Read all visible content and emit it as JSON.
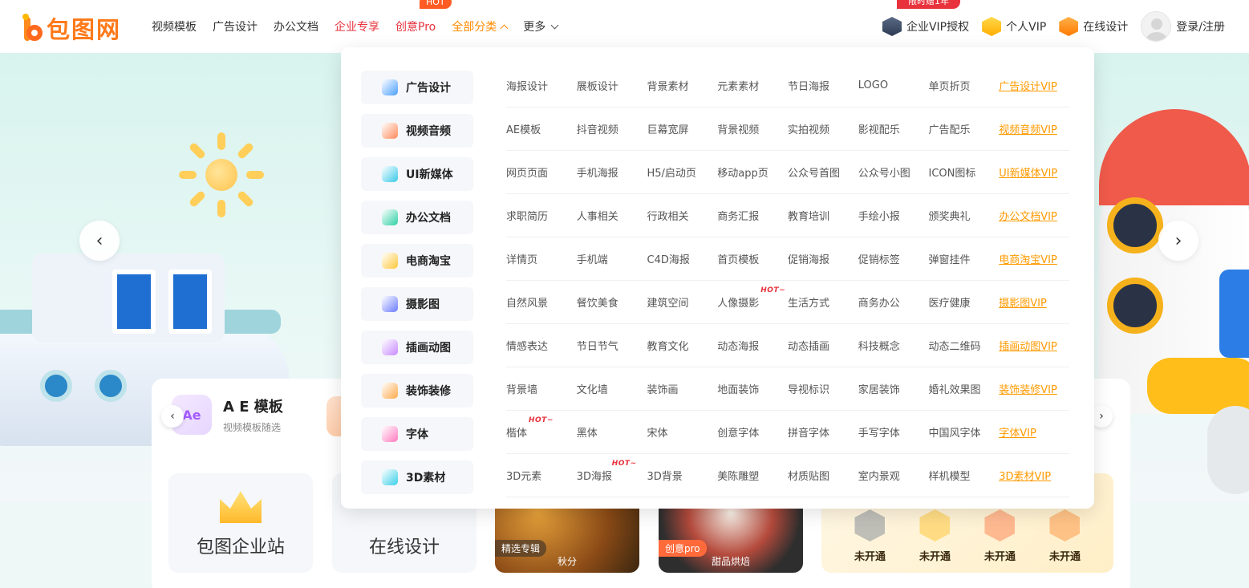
{
  "header": {
    "logo_text": "包图网",
    "nav": [
      {
        "label": "视频模板",
        "style": "normal"
      },
      {
        "label": "广告设计",
        "style": "normal"
      },
      {
        "label": "办公文档",
        "style": "normal"
      },
      {
        "label": "企业专享",
        "style": "red"
      },
      {
        "label": "创意Pro",
        "style": "red",
        "badge": "HOT"
      },
      {
        "label": "全部分类",
        "style": "orange"
      },
      {
        "label": "更多",
        "style": "normal"
      }
    ],
    "right": {
      "enterprise_vip": {
        "label": "企业VIP授权",
        "badge": "限时赠1年"
      },
      "personal_vip": "个人VIP",
      "online_design": "在线设计",
      "login": "登录/注册"
    }
  },
  "hero": {
    "prev_icon": "chevron-left-icon",
    "next_icon": "chevron-right-icon"
  },
  "quick_strip": {
    "ae_title": "A E 模板",
    "ae_subtitle": "视频模板随选",
    "ae_icon_text": "Ae"
  },
  "tiles": {
    "enterprise": "包图企业站",
    "online": "在线设计",
    "photo1": {
      "tag": "精选专辑",
      "caption": "秋分"
    },
    "photo2": {
      "tag": "创意pro",
      "caption": "甜品烘焙"
    },
    "vip_status": [
      "未开通",
      "未开通",
      "未开通",
      "未开通"
    ]
  },
  "dropdown": {
    "categories": [
      {
        "label": "广告设计",
        "color": "#4aa0ff",
        "items": [
          "海报设计",
          "展板设计",
          "背景素材",
          "元素素材",
          "节日海报",
          "LOGO",
          "单页折页"
        ],
        "vip": "广告设计VIP",
        "hot": []
      },
      {
        "label": "视频音频",
        "color": "#ff8a5a",
        "items": [
          "AE模板",
          "抖音视频",
          "巨幕宽屏",
          "背景视频",
          "实拍视频",
          "影视配乐",
          "广告配乐"
        ],
        "vip": "视频音频VIP",
        "hot": []
      },
      {
        "label": "UI新媒体",
        "color": "#3ac9e8",
        "items": [
          "网页页面",
          "手机海报",
          "H5/启动页",
          "移动app页",
          "公众号首图",
          "公众号小图",
          "ICON图标"
        ],
        "vip": "UI新媒体VIP",
        "hot": []
      },
      {
        "label": "办公文档",
        "color": "#2ed0a6",
        "items": [
          "求职简历",
          "人事相关",
          "行政相关",
          "商务汇报",
          "教育培训",
          "手绘小报",
          "颁奖典礼"
        ],
        "vip": "办公文档VIP",
        "hot": []
      },
      {
        "label": "电商淘宝",
        "color": "#ffc83a",
        "items": [
          "详情页",
          "手机端",
          "C4D海报",
          "首页模板",
          "促销海报",
          "促销标签",
          "弹窗挂件"
        ],
        "vip": "电商淘宝VIP",
        "hot": []
      },
      {
        "label": "摄影图",
        "color": "#6a7bff",
        "items": [
          "自然风景",
          "餐饮美食",
          "建筑空间",
          "人像摄影",
          "生活方式",
          "商务办公",
          "医疗健康"
        ],
        "vip": "摄影图VIP",
        "hot": [
          3
        ]
      },
      {
        "label": "插画动图",
        "color": "#c88aff",
        "items": [
          "情感表达",
          "节日节气",
          "教育文化",
          "动态海报",
          "动态插画",
          "科技概念",
          "动态二维码"
        ],
        "vip": "插画动图VIP",
        "hot": []
      },
      {
        "label": "装饰装修",
        "color": "#ffaa4a",
        "items": [
          "背景墙",
          "文化墙",
          "装饰画",
          "地面装饰",
          "导视标识",
          "家居装饰",
          "婚礼效果图"
        ],
        "vip": "装饰装修VIP",
        "hot": []
      },
      {
        "label": "字体",
        "color": "#ff7ac0",
        "items": [
          "楷体",
          "黑体",
          "宋体",
          "创意字体",
          "拼音字体",
          "手写字体",
          "中国风字体"
        ],
        "vip": "字体VIP",
        "hot": [
          0
        ]
      },
      {
        "label": "3D素材",
        "color": "#3ad0e8",
        "items": [
          "3D元素",
          "3D海报",
          "3D背景",
          "美陈雕塑",
          "材质贴图",
          "室内景观",
          "样机模型"
        ],
        "vip": "3D素材VIP",
        "hot": [
          1
        ]
      }
    ],
    "hot_label": "HOT~"
  }
}
